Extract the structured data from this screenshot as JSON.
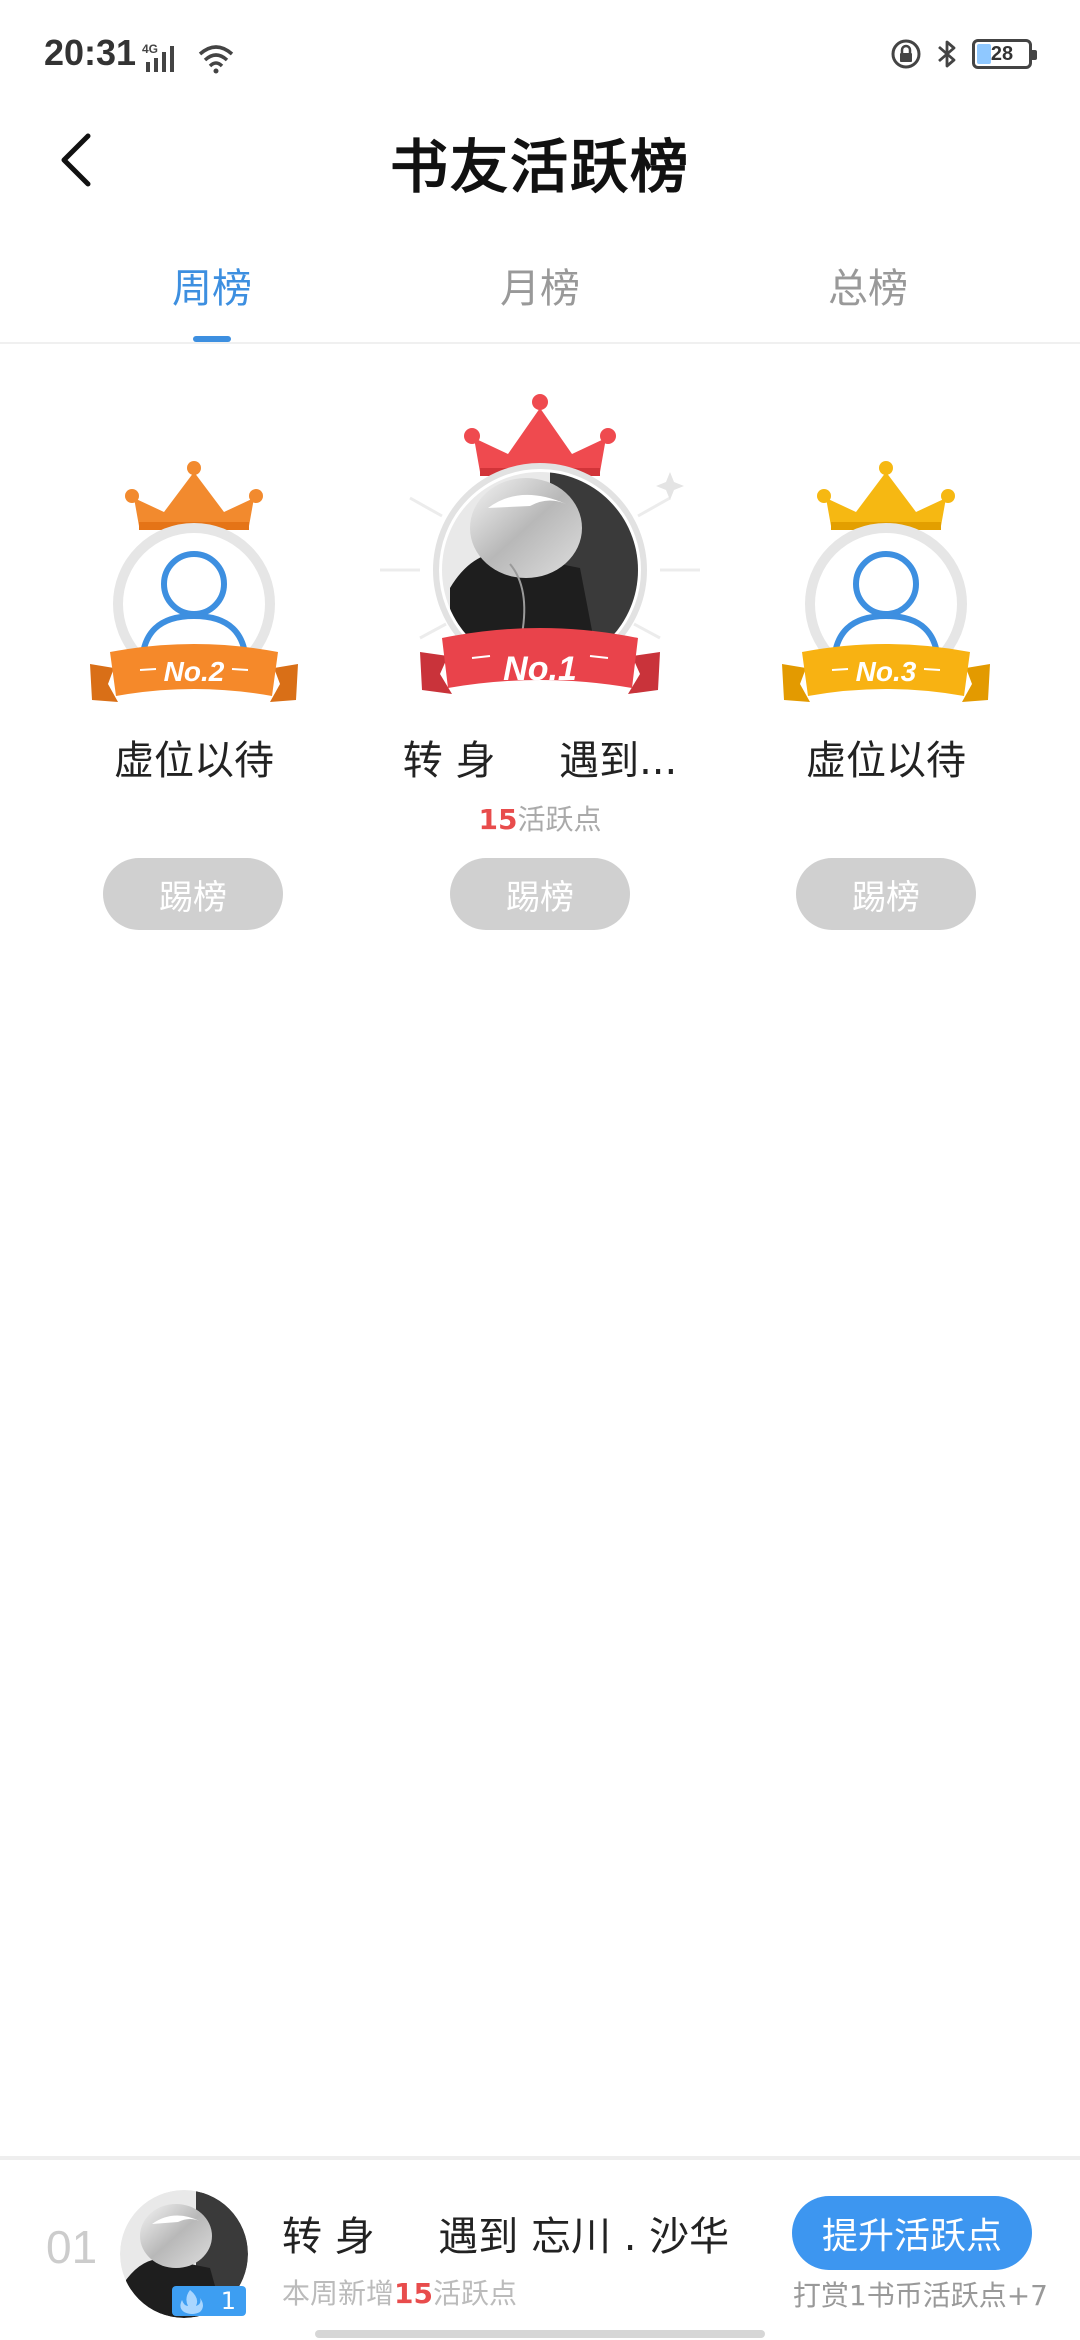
{
  "status_bar": {
    "time": "20:31",
    "network": "4G",
    "battery": "28",
    "icons": [
      "signal-icon",
      "wifi-icon",
      "lock-rotation-icon",
      "bluetooth-icon",
      "battery-icon"
    ]
  },
  "header": {
    "title": "书友活跃榜",
    "back_icon": "chevron-left-icon"
  },
  "tabs": [
    {
      "label": "周榜",
      "active": true
    },
    {
      "label": "月榜",
      "active": false
    },
    {
      "label": "总榜",
      "active": false
    }
  ],
  "podium": {
    "first": {
      "rank_label": "No.1",
      "name": "转 身     遇到...",
      "points_value": "15",
      "points_unit": "活跃点",
      "button": "踢榜",
      "ribbon_color": "#e9434b",
      "crown_color": "#ef4a4f"
    },
    "second": {
      "rank_label": "No.2",
      "name": "虚位以待",
      "button": "踢榜",
      "ribbon_color": "#f5892a",
      "crown_color": "#f28a2e"
    },
    "third": {
      "rank_label": "No.3",
      "name": "虚位以待",
      "button": "踢榜",
      "ribbon_color": "#f8b212",
      "crown_color": "#f6b812"
    }
  },
  "my_rank": {
    "rank": "01",
    "name": "转 身     遇到 忘川 . 沙华",
    "level": "1",
    "sub_prefix": "本周新增",
    "sub_value": "15",
    "sub_suffix": "活跃点",
    "boost_button": "提升活跃点",
    "reward_tip": "打赏1书币活跃点+7"
  },
  "colors": {
    "accent": "#3d8fe0",
    "highlight": "#e84c4c",
    "button_disabled": "#d0d0d0"
  }
}
